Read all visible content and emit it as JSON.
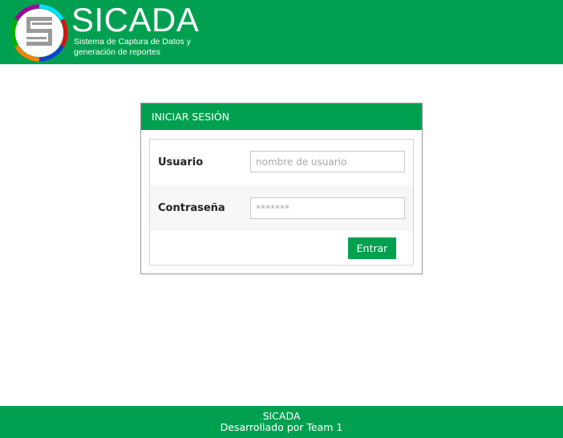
{
  "header": {
    "brand": "SICADA",
    "subtitle_line1": "Sistema de Captura de Datos y",
    "subtitle_line2": "generación de reportes",
    "logo_icon": "sicada-logo-icon"
  },
  "login": {
    "heading": "INICIAR SESIÓN",
    "username_label": "Usuario",
    "username_placeholder": "nombre de usuario",
    "username_value": "",
    "password_label": "Contraseña",
    "password_placeholder": "*******",
    "password_value": "",
    "submit_label": "Entrar"
  },
  "footer": {
    "line1": "SICADA",
    "line2": "Desarrollado por Team 1"
  },
  "colors": {
    "brand_green": "#00a050",
    "logo_ring": [
      "#00e0ff",
      "#1040d0",
      "#ff8000",
      "#00b000",
      "#e01010",
      "#a000a0"
    ]
  }
}
